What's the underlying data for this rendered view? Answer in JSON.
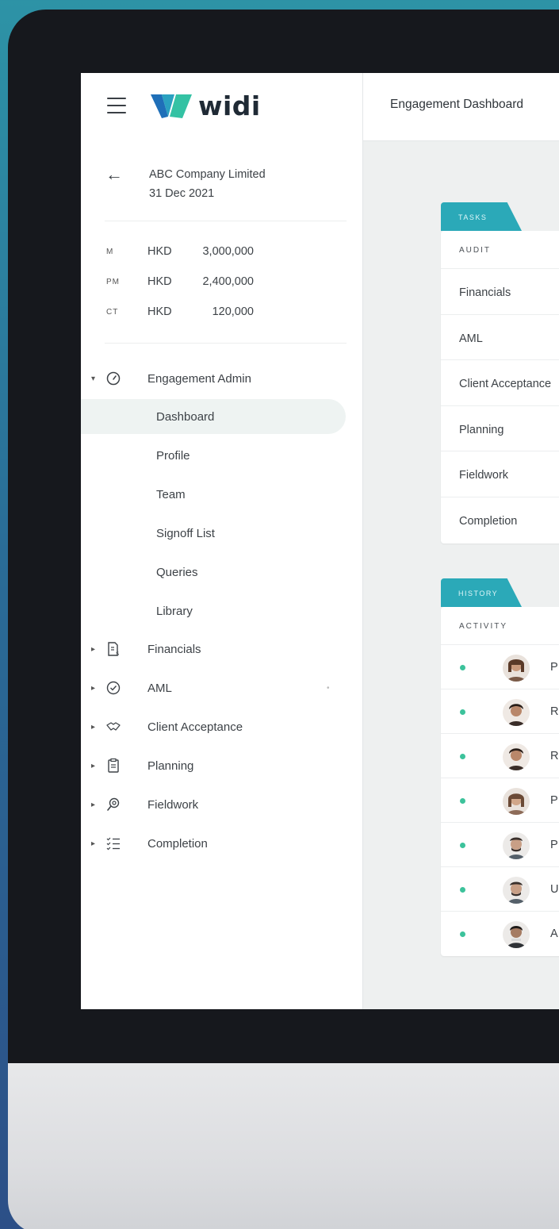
{
  "app": {
    "logo_text": "widi"
  },
  "header": {
    "title": "Engagement Dashboard"
  },
  "engagement": {
    "company": "ABC Company Limited",
    "date": "31 Dec 2021"
  },
  "amounts": [
    {
      "code": "M",
      "currency": "HKD",
      "value": "3,000,000"
    },
    {
      "code": "PM",
      "currency": "HKD",
      "value": "2,400,000"
    },
    {
      "code": "CT",
      "currency": "HKD",
      "value": "120,000"
    }
  ],
  "nav": {
    "engagement_admin": {
      "label": "Engagement Admin",
      "icon": "gauge-icon",
      "children": [
        "Dashboard",
        "Profile",
        "Team",
        "Signoff List",
        "Queries",
        "Library"
      ],
      "active": "Dashboard"
    },
    "sections": [
      {
        "label": "Financials",
        "icon": "document-dollar-icon"
      },
      {
        "label": "AML",
        "icon": "check-circle-icon"
      },
      {
        "label": "Client Acceptance",
        "icon": "handshake-icon"
      },
      {
        "label": "Planning",
        "icon": "clipboard-icon"
      },
      {
        "label": "Fieldwork",
        "icon": "magnifier-icon"
      },
      {
        "label": "Completion",
        "icon": "checklist-icon"
      }
    ]
  },
  "tasks": {
    "tab": "TASKS",
    "column": "AUDIT",
    "rows": [
      "Financials",
      "AML",
      "Client Acceptance",
      "Planning",
      "Fieldwork",
      "Completion"
    ]
  },
  "history": {
    "tab": "HISTORY",
    "column": "ACTIVITY",
    "rows": [
      "P",
      "R",
      "R",
      "P",
      "P",
      "U",
      "A"
    ]
  },
  "colors": {
    "accent": "#2ba9b8",
    "status_dot": "#3cc29b",
    "active_bg": "#eef3f2"
  }
}
